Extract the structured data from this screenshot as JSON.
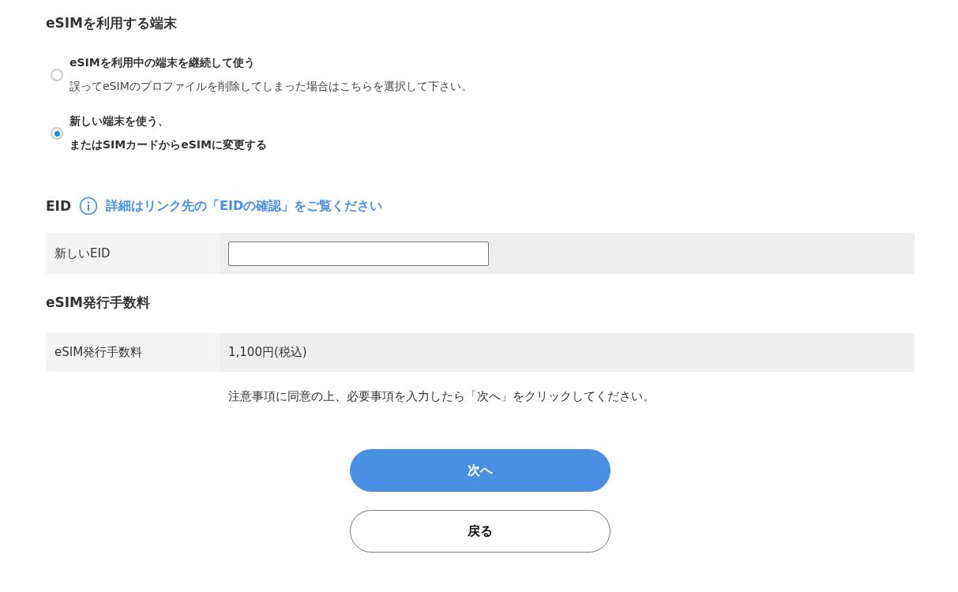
{
  "device_section": {
    "title": "eSIMを利用する端末",
    "options": [
      {
        "lines": [
          "eSIMを利用中の端末を継続して使う"
        ],
        "description": "誤ってeSIMのプロファイルを削除してしまった場合はこちらを選択して下さい。",
        "selected": false
      },
      {
        "lines": [
          "新しい端末を使う、",
          "またはSIMカードからeSIMに変更する"
        ],
        "selected": true
      }
    ]
  },
  "eid_section": {
    "title": "EID",
    "info_link": "詳細はリンク先の「EIDの確認」をご覧ください",
    "row": {
      "label": "新しいEID"
    }
  },
  "fee_section": {
    "title": "eSIM発行手数料",
    "row": {
      "label": "eSIM発行手数料",
      "value": "1,100円(税込)"
    }
  },
  "notice": "注意事項に同意の上、必要事項を入力したら「次へ」をクリックしてください。",
  "buttons": [
    {
      "label": "次へ",
      "kind": "primary"
    },
    {
      "label": "戻る",
      "kind": "secondary"
    }
  ]
}
